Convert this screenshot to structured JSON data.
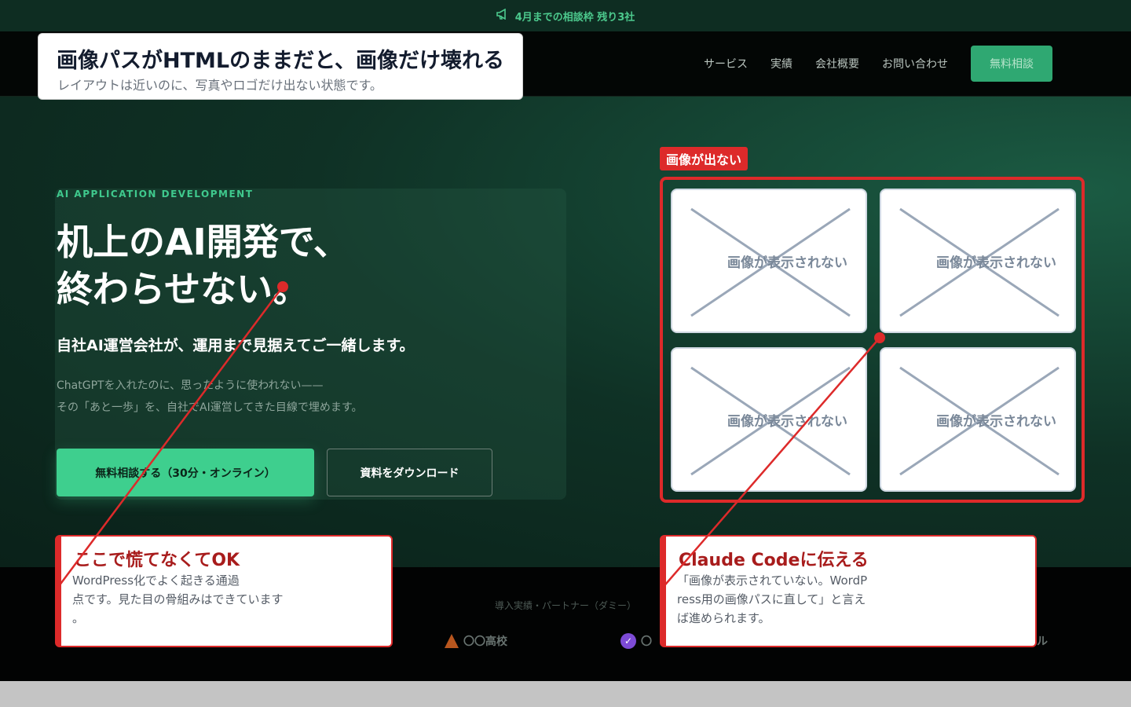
{
  "topbar": {
    "icon": "megaphone-icon",
    "text": "4月までの相談枠 残り3社"
  },
  "header": {
    "nav": [
      "サービス",
      "実績",
      "会社概要",
      "お問い合わせ"
    ],
    "cta": "無料相談"
  },
  "hero": {
    "eyebrow": "AI APPLICATION DEVELOPMENT",
    "title_line1": "机上のAI開発で、",
    "title_line2": "終わらせない。",
    "lead": "自社AI運営会社が、運用まで見据えてご一緒します。",
    "desc_line1": "ChatGPTを入れたのに、思ったように使われない——",
    "desc_line2": "その「あと一歩」を、自社でAI運営してきた目線で埋めます。",
    "btn_primary": "無料相談する（30分・オンライン）",
    "btn_secondary": "資料をダウンロード"
  },
  "partners": {
    "title": "導入実績・パートナー（ダミー）",
    "items": [
      "〇〇高校",
      "〇",
      "ル"
    ]
  },
  "annotations": {
    "top_title": "画像パスがHTMLのままだと、画像だけ壊れる",
    "top_sub": "レイアウトは近いのに、写真やロゴだけ出ない状態です。",
    "red_label": "画像が出ない",
    "broken_image_text": "画像が表示されない",
    "note_left_title": "ここで慌てなくてOK",
    "note_left_body1": "WordPress化でよく起きる通過",
    "note_left_body2": "点です。見た目の骨組みはできています",
    "note_left_body3": "。",
    "note_right_title": "Claude Codeに伝える",
    "note_right_body1": "「画像が表示されていない。WordP",
    "note_right_body2": "ress用の画像パスに直して」と言え",
    "note_right_body3": "ば進められます。"
  },
  "colors": {
    "accent": "#3ecf8e",
    "annotation_red": "#dd2a2a",
    "hero_bg": "#0f3125"
  }
}
